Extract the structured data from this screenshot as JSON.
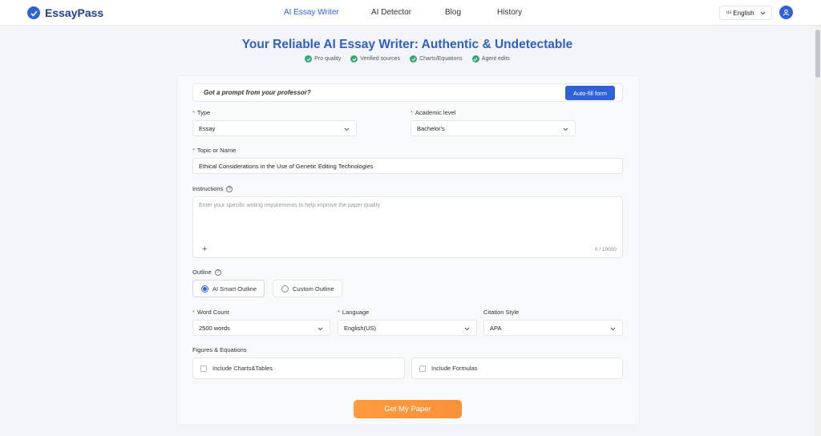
{
  "header": {
    "brand": "EssayPass",
    "nav": [
      "AI Essay Writer",
      "AI Detector",
      "Blog",
      "History"
    ],
    "active_nav": "AI Essay Writer",
    "lang_flag": "us",
    "lang_label": "English"
  },
  "hero": {
    "title": "Your Reliable AI Essay Writer: Authentic & Undetectable",
    "features": [
      "Pro quality",
      "Verified sources",
      "Charts/Equations",
      "Agent edits"
    ]
  },
  "form": {
    "prompt_text": "Got a prompt from your professor?",
    "autofill_label": "Auto-fill form",
    "type_label": "Type",
    "type_value": "Essay",
    "level_label": "Academic level",
    "level_value": "Bachelor's",
    "topic_label": "Topic or Name",
    "topic_value": "Ethical Considerations in the Use of Genetic Editing Technologies",
    "instructions_label": "Instructions",
    "instructions_placeholder": "Enter your specific writing requirements to help improve the paper quality",
    "instructions_plus": "+",
    "instructions_count": "0 / 10000",
    "outline_label": "Outline",
    "outline_options": [
      "AI Smart Outline",
      "Custom Outline"
    ],
    "outline_selected": "AI Smart Outline",
    "wordcount_label": "Word Count",
    "wordcount_value": "2500 words",
    "language_label": "Language",
    "language_value": "English(US)",
    "citation_label": "Citation Style",
    "citation_value": "APA",
    "figures_label": "Figures & Equations",
    "figure_options": [
      "Include Charts&Tables",
      "Include Formulas"
    ],
    "submit_label": "Get My Paper",
    "required_mark": "*",
    "help_mark": "?"
  },
  "colors": {
    "brand_blue": "#2f62d8",
    "accent_orange": "#f7923a",
    "check_green": "#37a874",
    "required_red": "#e2573d"
  },
  "icons": {
    "logo": "essaypass-logo-icon",
    "chevron": "chevron-down-icon",
    "user": "user-icon",
    "check": "check-circle-icon",
    "help": "help-circle-icon"
  }
}
